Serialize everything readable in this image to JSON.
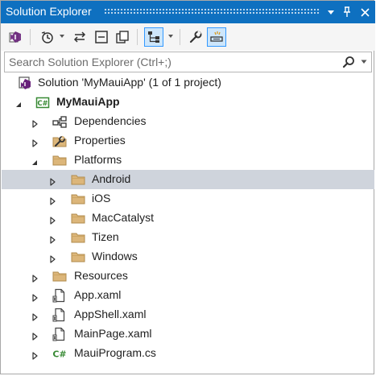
{
  "window": {
    "title": "Solution Explorer",
    "accent_color": "#0e70c0",
    "title_buttons": [
      {
        "name": "dropdown-arrow-icon",
        "glyph": "▾"
      },
      {
        "name": "pin-icon",
        "glyph": "⊣"
      },
      {
        "name": "close-icon",
        "glyph": "✕"
      }
    ]
  },
  "toolbar": {
    "tools": [
      {
        "name": "visual-studio-icon",
        "active": false
      },
      {
        "name": "history-icon",
        "active": false
      },
      {
        "name": "sync-icon",
        "active": false
      },
      {
        "name": "collapse-all-icon",
        "active": false
      },
      {
        "name": "show-all-files-icon",
        "active": false
      },
      {
        "name": "switch-views-icon",
        "active": true
      },
      {
        "name": "properties-wrench-icon",
        "active": false
      },
      {
        "name": "preview-selected-icon",
        "active": true
      }
    ]
  },
  "search": {
    "placeholder": "Search Solution Explorer (Ctrl+;)"
  },
  "tree": {
    "items": [
      {
        "label": "Solution 'MyMauiApp' (1 of 1 project)",
        "icon": "solution-icon",
        "level": 0,
        "expander": "none",
        "bold": false,
        "selected": false
      },
      {
        "label": "MyMauiApp",
        "icon": "csharp-project-icon",
        "level": 0,
        "expander": "expanded",
        "bold": true,
        "selected": false
      },
      {
        "label": "Dependencies",
        "icon": "dependencies-icon",
        "level": 1,
        "expander": "collapsed",
        "bold": false,
        "selected": false
      },
      {
        "label": "Properties",
        "icon": "properties-icon",
        "level": 1,
        "expander": "collapsed",
        "bold": false,
        "selected": false
      },
      {
        "label": "Platforms",
        "icon": "folder-icon",
        "level": 1,
        "expander": "expanded",
        "bold": false,
        "selected": false
      },
      {
        "label": "Android",
        "icon": "folder-icon",
        "level": 2,
        "expander": "collapsed",
        "bold": false,
        "selected": true
      },
      {
        "label": "iOS",
        "icon": "folder-icon",
        "level": 2,
        "expander": "collapsed",
        "bold": false,
        "selected": false
      },
      {
        "label": "MacCatalyst",
        "icon": "folder-icon",
        "level": 2,
        "expander": "collapsed",
        "bold": false,
        "selected": false
      },
      {
        "label": "Tizen",
        "icon": "folder-icon",
        "level": 2,
        "expander": "collapsed",
        "bold": false,
        "selected": false
      },
      {
        "label": "Windows",
        "icon": "folder-icon",
        "level": 2,
        "expander": "collapsed",
        "bold": false,
        "selected": false
      },
      {
        "label": "Resources",
        "icon": "folder-icon",
        "level": 1,
        "expander": "collapsed",
        "bold": false,
        "selected": false
      },
      {
        "label": "App.xaml",
        "icon": "xaml-file-icon",
        "level": 1,
        "expander": "collapsed",
        "bold": false,
        "selected": false
      },
      {
        "label": "AppShell.xaml",
        "icon": "xaml-file-icon",
        "level": 1,
        "expander": "collapsed",
        "bold": false,
        "selected": false
      },
      {
        "label": "MainPage.xaml",
        "icon": "xaml-file-icon",
        "level": 1,
        "expander": "collapsed",
        "bold": false,
        "selected": false
      },
      {
        "label": "MauiProgram.cs",
        "icon": "csharp-file-icon",
        "level": 1,
        "expander": "collapsed",
        "bold": false,
        "selected": false
      }
    ]
  }
}
